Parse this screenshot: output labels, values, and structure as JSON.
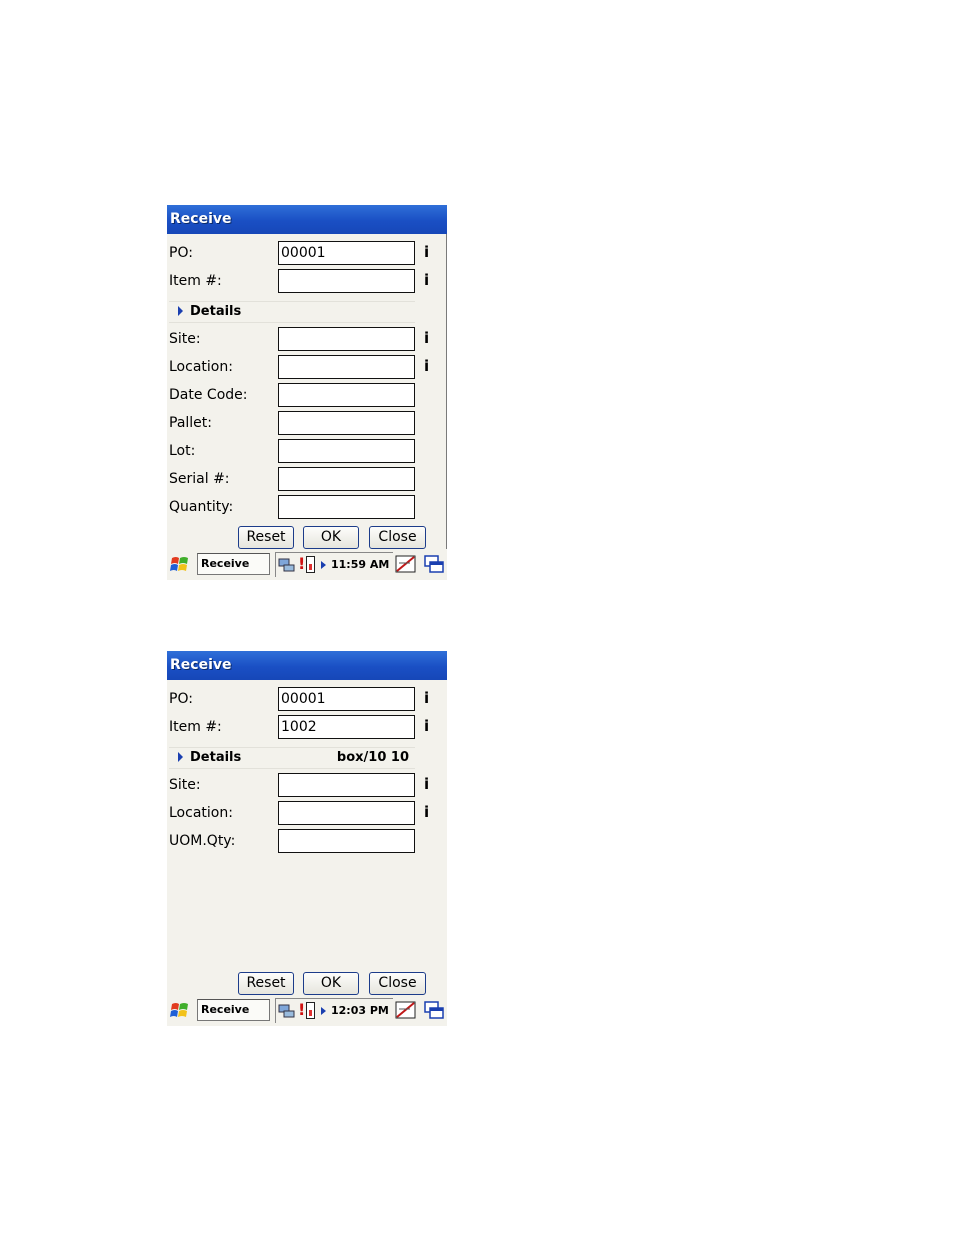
{
  "screens": [
    {
      "title": "Receive",
      "rows_top": [
        {
          "label": "PO:",
          "value": "00001",
          "info": "i"
        },
        {
          "label": "Item #:",
          "value": "",
          "info": "i"
        }
      ],
      "details": {
        "label": "Details",
        "value": ""
      },
      "rows": [
        {
          "label": "Site:",
          "value": "",
          "info": "i"
        },
        {
          "label": "Location:",
          "value": "",
          "info": "i"
        },
        {
          "label": "Date Code:",
          "value": "",
          "info": ""
        },
        {
          "label": "Pallet:",
          "value": "",
          "info": ""
        },
        {
          "label": "Lot:",
          "value": "",
          "info": ""
        },
        {
          "label": "Serial #:",
          "value": "",
          "info": ""
        },
        {
          "label": "Quantity:",
          "value": "",
          "info": ""
        }
      ],
      "buttons": {
        "reset": "Reset",
        "ok": "OK",
        "close": "Close"
      },
      "taskbar": {
        "task": "Receive",
        "time": "11:59 AM"
      }
    },
    {
      "title": "Receive",
      "rows_top": [
        {
          "label": "PO:",
          "value": "00001",
          "info": "i"
        },
        {
          "label": "Item #:",
          "value": "1002",
          "info": "i"
        }
      ],
      "details": {
        "label": "Details",
        "value": "box/10 10"
      },
      "rows": [
        {
          "label": "Site:",
          "value": "",
          "info": "i"
        },
        {
          "label": "Location:",
          "value": "",
          "info": "i"
        },
        {
          "label": "UOM.Qty:",
          "value": "",
          "info": ""
        }
      ],
      "buttons": {
        "reset": "Reset",
        "ok": "OK",
        "close": "Close"
      },
      "taskbar": {
        "task": "Receive",
        "time": "12:03 PM"
      }
    }
  ],
  "colors": {
    "titlebar": "#1a4fc4",
    "form_bg": "#f3f2ec",
    "battery": "#e03030"
  },
  "icons": [
    "windows-start-icon",
    "network-icon",
    "battery-icon",
    "keyboard-icon",
    "window-switch-icon"
  ]
}
